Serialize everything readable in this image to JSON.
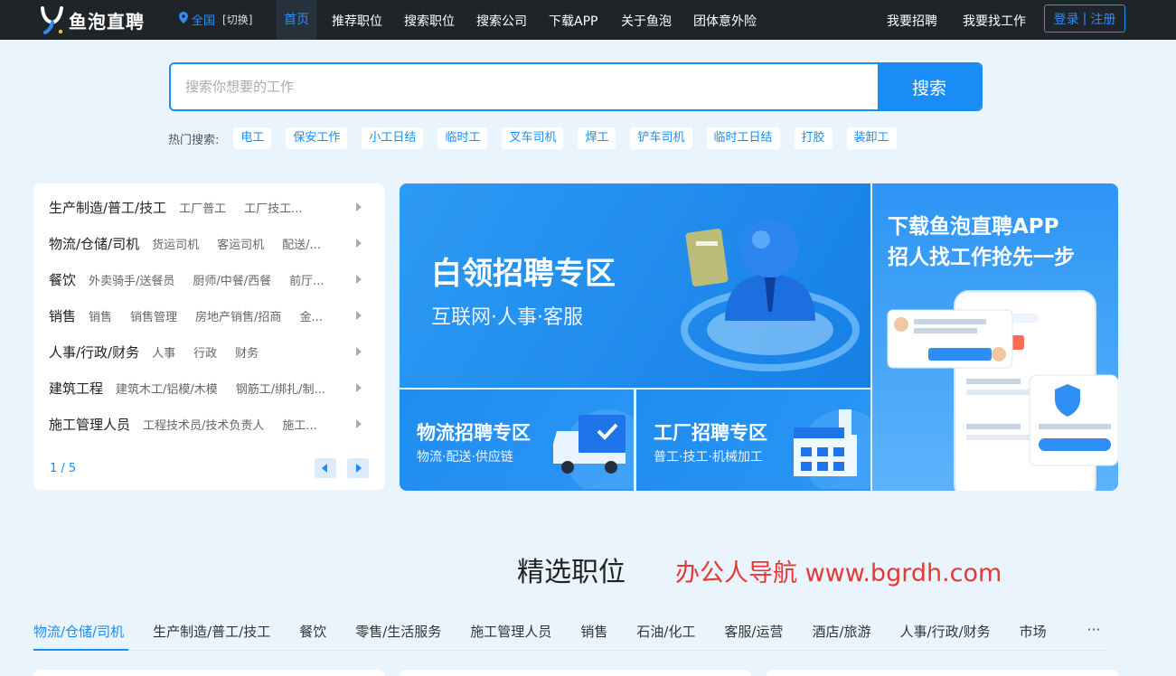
{
  "header": {
    "logo_text": "鱼泡直聘",
    "location": {
      "city": "全国",
      "switch": "[切换]"
    },
    "nav": [
      "首页",
      "推荐职位",
      "搜索职位",
      "搜索公司",
      "下载APP",
      "关于鱼泡",
      "团体意外险"
    ],
    "right_links": [
      "我要招聘",
      "我要找工作"
    ],
    "login": "登录",
    "register": "注册",
    "divider": "|"
  },
  "search": {
    "placeholder": "搜索你想要的工作",
    "button": "搜索",
    "hot_label": "热门搜索:",
    "hot_tags": [
      "电工",
      "保安工作",
      "小工日结",
      "临时工",
      "叉车司机",
      "焊工",
      "铲车司机",
      "临时工日结",
      "打胶",
      "装卸工"
    ]
  },
  "categories": {
    "rows": [
      {
        "main": "生产制造/普工/技工",
        "subs": [
          "工厂普工",
          "工厂技工..."
        ]
      },
      {
        "main": "物流/仓储/司机",
        "subs": [
          "货运司机",
          "客运司机",
          "配送/..."
        ]
      },
      {
        "main": "餐饮",
        "subs": [
          "外卖骑手/送餐员",
          "厨师/中餐/西餐",
          "前厅..."
        ]
      },
      {
        "main": "销售",
        "subs": [
          "销售",
          "销售管理",
          "房地产销售/招商",
          "金..."
        ]
      },
      {
        "main": "人事/行政/财务",
        "subs": [
          "人事",
          "行政",
          "财务"
        ]
      },
      {
        "main": "建筑工程",
        "subs": [
          "建筑木工/铝模/木模",
          "钢筋工/绑扎/制..."
        ]
      },
      {
        "main": "施工管理人员",
        "subs": [
          "工程技术员/技术负责人",
          "施工..."
        ]
      }
    ],
    "pager": "1 / 5"
  },
  "banners": {
    "white_collar": {
      "title": "白领招聘专区",
      "subtitle": "互联网·人事·客服"
    },
    "logistics": {
      "title": "物流招聘专区",
      "subtitle": "物流·配送·供应链"
    },
    "factory": {
      "title": "工厂招聘专区",
      "subtitle": "普工·技工·机械加工"
    },
    "app": {
      "line1": "下载鱼泡直聘APP",
      "line2": "招人找工作抢先一步"
    }
  },
  "featured": {
    "title": "精选职位",
    "watermark": "办公人导航 www.bgrdh.com",
    "tabs": [
      "物流/仓储/司机",
      "生产制造/普工/技工",
      "餐饮",
      "零售/生活服务",
      "施工管理人员",
      "销售",
      "石油/化工",
      "客服/运营",
      "酒店/旅游",
      "人事/行政/财务",
      "市场"
    ],
    "more": "···"
  },
  "colors": {
    "accent": "#1a8cf5",
    "topbar": "#1f2429",
    "page_bg": "#eaf4fd",
    "watermark": "#e53935"
  }
}
